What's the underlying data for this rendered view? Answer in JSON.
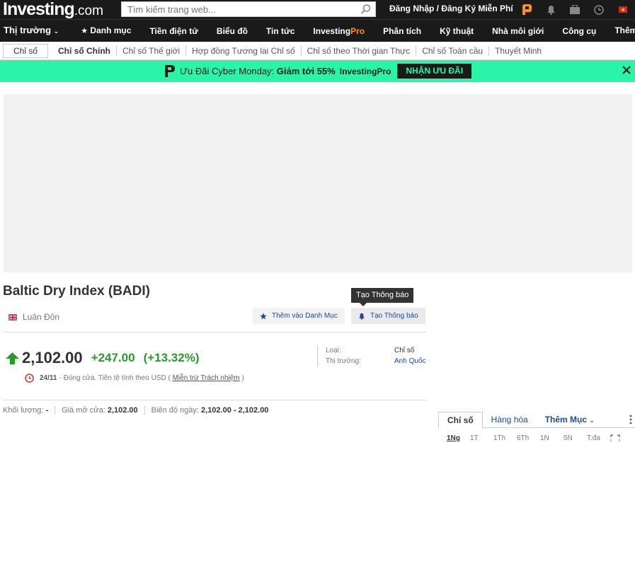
{
  "header": {
    "logo_main": "Investing",
    "logo_suffix": ".com",
    "search_placeholder": "Tìm kiếm trang web...",
    "signin": "Đăng Nhập / Đăng Ký Miễn Phí"
  },
  "mainnav": {
    "items": [
      "Thị trường",
      "Danh mục",
      "Tiền điện tử",
      "Biểu đồ",
      "Tin tức",
      "InvestingPro",
      "Phân tích",
      "Kỹ thuật",
      "Nhà môi giới",
      "Công cụ",
      "Thêm"
    ],
    "pro_a": "Investing",
    "pro_b": "Pro"
  },
  "subnav": {
    "root": "Chỉ số",
    "items": [
      "Chỉ số Chính",
      "Chỉ số Thế giới",
      "Hợp đồng Tương lai Chỉ số",
      "Chỉ số theo Thời gian Thực",
      "Chỉ số Toàn cầu",
      "Thuyết Minh"
    ]
  },
  "promo": {
    "text": "Ưu Đãi Cyber Monday: ",
    "bold": "Giảm tới 55%",
    "brand": "InvestingPro",
    "cta": "NHẬN ƯU ĐÃI"
  },
  "instrument": {
    "title": "Baltic Dry Index (BADI)",
    "location": "Luân Đôn",
    "tooltip": "Tạo Thông báo",
    "watchlist_btn": "Thêm vào Danh Mục",
    "alert_btn": "Tạo Thông báo",
    "price": "2,102.00",
    "change": "+247.00",
    "change_pct": "(+13.32%)",
    "date": "24/11",
    "status_text": "- Đóng cửa. Tiền tệ tính theo USD (",
    "disclaimer": "Miễn trừ Trách nhiệm",
    "status_end": ")",
    "meta": {
      "type_label": "Loại:",
      "type_value": "Chỉ số",
      "market_label": "Thị trường:",
      "market_value": "Anh Quốc"
    },
    "stats": {
      "volume_label": "Khối lượng:",
      "volume_value": "-",
      "open_label": "Giá mở cửa:",
      "open_value": "2,102.00",
      "range_label": "Biên độ ngày:",
      "range_value": "2,102.00 - 2,102.00"
    }
  },
  "widget": {
    "tabs": [
      "Chỉ số",
      "Hàng hóa",
      "Thêm Mục"
    ],
    "periods": [
      "1Ng",
      "1T",
      "1Th",
      "6Th",
      "1N",
      "5N",
      "T.đa"
    ]
  },
  "colors": {
    "accent_green": "#2b9a2e",
    "promo_bg": "#2af5a7",
    "link_blue": "#1c4b8c",
    "brand_orange": "#f7931e"
  }
}
